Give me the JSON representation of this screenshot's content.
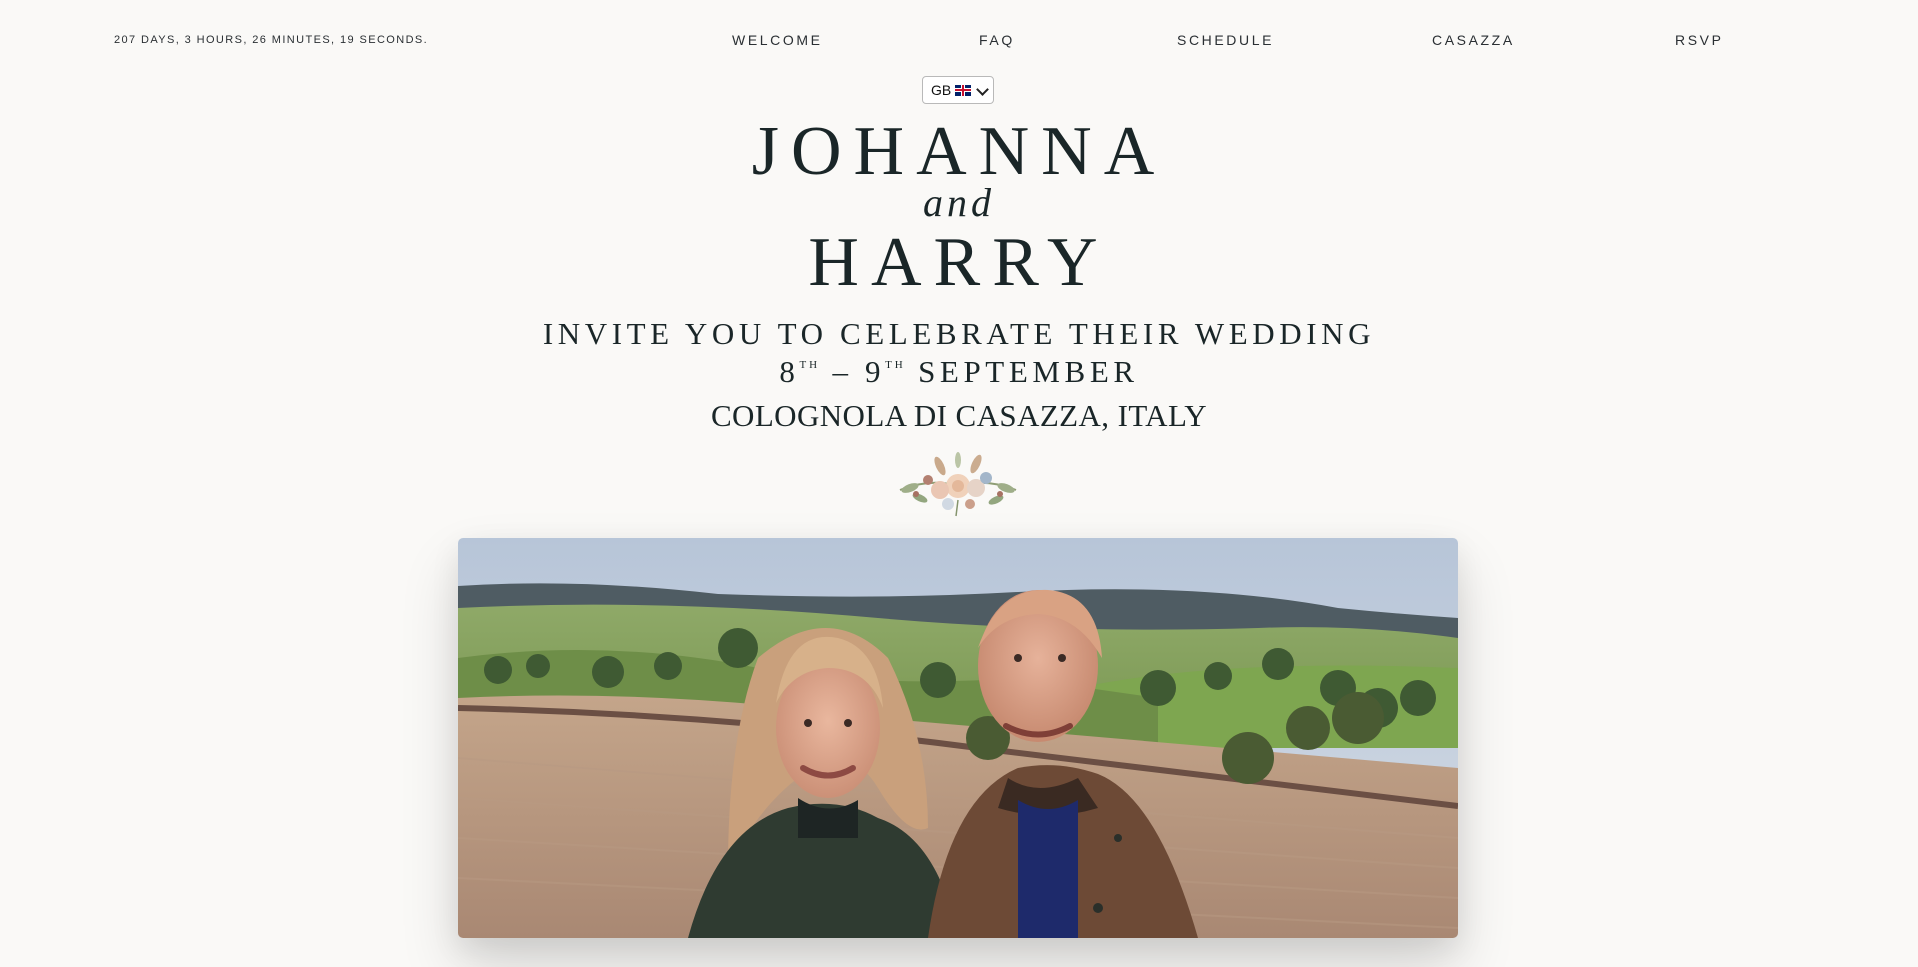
{
  "countdown": "207 DAYS, 3 HOURS, 26 MINUTES, 19 SECONDS.",
  "nav": {
    "welcome": "WELCOME",
    "faq": "FAQ",
    "schedule": "SCHEDULE",
    "casazza": "CASAZZA",
    "rsvp": "RSVP"
  },
  "language": {
    "selected": "GB",
    "flag_icon": "uk-flag-icon"
  },
  "hero": {
    "name_1": "JOHANNA",
    "and": "and",
    "name_2": "HARRY",
    "invite": "INVITE YOU TO CELEBRATE THEIR WEDDING",
    "date_start": "8",
    "date_start_suffix": "TH",
    "date_dash": "–",
    "date_end": "9",
    "date_end_suffix": "TH",
    "date_month": "SEPTEMBER",
    "place": "COLOGNOLA DI CASAZZA, ITALY"
  },
  "colors": {
    "background": "#faf9f7",
    "text": "#1a2628"
  }
}
